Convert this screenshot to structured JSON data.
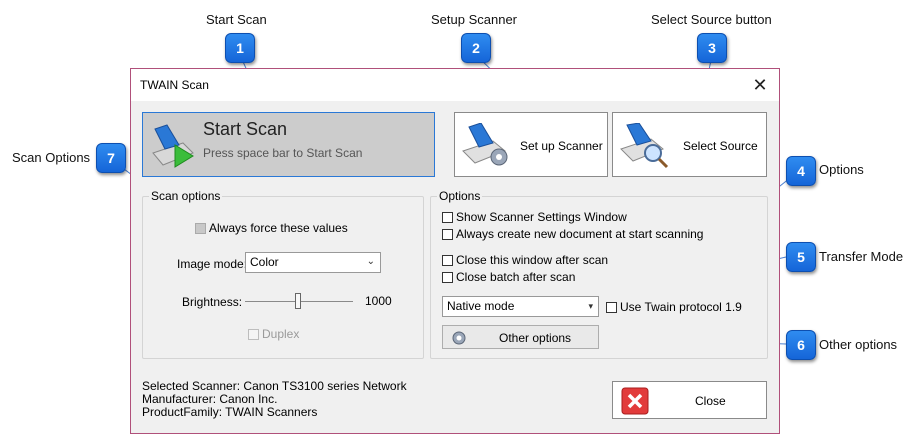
{
  "callouts": [
    {
      "number": "1",
      "label": "Start Scan"
    },
    {
      "number": "2",
      "label": "Setup Scanner"
    },
    {
      "number": "3",
      "label": "Select Source button"
    },
    {
      "number": "4",
      "label": "Options"
    },
    {
      "number": "5",
      "label": "Transfer Mode"
    },
    {
      "number": "6",
      "label": "Other options"
    },
    {
      "number": "7",
      "label": "Scan Options"
    }
  ],
  "window": {
    "title": "TWAIN Scan",
    "close_glyph": "✕"
  },
  "start_scan": {
    "title": "Start Scan",
    "subtitle": "Press space bar to Start Scan"
  },
  "setup_scanner": {
    "label": "Set up Scanner"
  },
  "select_source": {
    "label": "Select Source"
  },
  "scan_options": {
    "title": "Scan options",
    "always_force": "Always force these values",
    "image_mode_label": "Image mode:",
    "image_mode_value": "Color",
    "brightness_label": "Brightness:",
    "brightness_value": "1000",
    "duplex": "Duplex"
  },
  "options": {
    "title": "Options",
    "show_settings": "Show Scanner Settings Window",
    "always_new_doc": "Always create new document at start scanning",
    "close_window": "Close this window after scan",
    "close_batch": "Close batch after scan",
    "transfer_mode": "Native mode",
    "twain_protocol": "Use Twain protocol 1.9",
    "other_options": "Other options"
  },
  "scanner_info": {
    "selected": "Selected Scanner: Canon TS3100 series Network",
    "manufacturer": "Manufacturer: Canon Inc.",
    "family": "ProductFamily: TWAIN Scanners"
  },
  "close_button": {
    "label": "Close"
  },
  "colors": {
    "badge": "#1f77e6",
    "accent_border": "#2a78d6",
    "window_border": "#b0507a",
    "close_red": "#e23b3b"
  }
}
